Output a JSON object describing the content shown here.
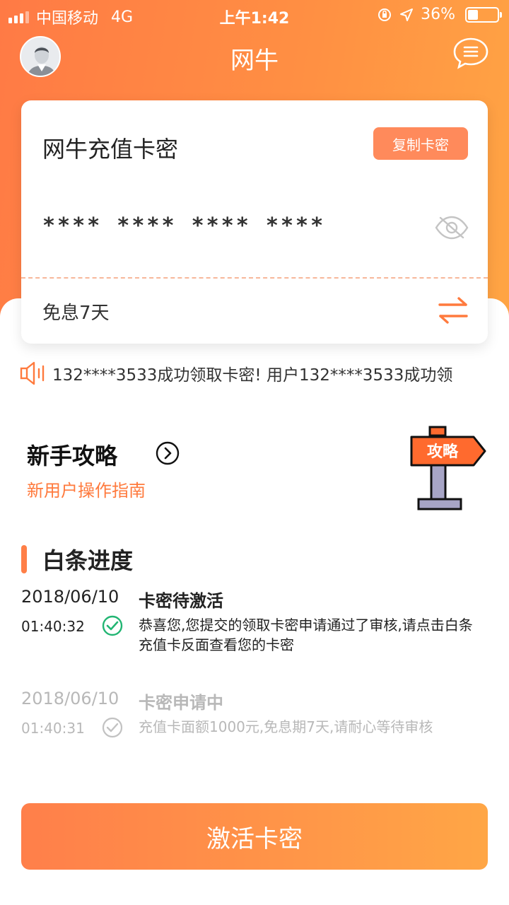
{
  "status_bar": {
    "carrier": "中国移动",
    "network": "4G",
    "time": "上午1:42",
    "battery": "36%"
  },
  "header": {
    "title": "网牛"
  },
  "card": {
    "title": "网牛充值卡密",
    "copy_button": "复制卡密",
    "code": "**** **** **** ****",
    "interest_free": "免息7天"
  },
  "notice": {
    "text": "132****3533成功领取卡密!  用户132****3533成功领"
  },
  "guide": {
    "title": "新手攻略",
    "subtitle": "新用户操作指南",
    "sign_text": "攻略"
  },
  "progress": {
    "heading": "白条进度",
    "entries": [
      {
        "date": "2018/06/10",
        "time": "01:40:32",
        "status": "卡密待激活",
        "description": "恭喜您,您提交的领取卡密申请通过了审核,请点击白条充值卡反面查看您的卡密",
        "state": "active"
      },
      {
        "date": "2018/06/10",
        "time": "01:40:31",
        "status": "卡密申请中",
        "description": "充值卡面额1000元,免息期7天,请耐心等待审核",
        "state": "done"
      }
    ]
  },
  "actions": {
    "activate": "激活卡密"
  },
  "colors": {
    "accent": "#ff7f47",
    "check_active": "#22b573",
    "inactive_text": "#b8b8b8"
  }
}
